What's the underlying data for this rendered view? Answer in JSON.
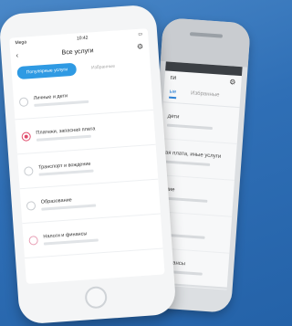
{
  "front_phone": {
    "status": {
      "carrier": "Mega ",
      "time": "10:42",
      "battery": ""
    },
    "nav": {
      "title": "Все услуги"
    },
    "tabs": {
      "active": "Популярные услуги",
      "inactive": "Избранные"
    },
    "items": [
      {
        "label": "Личные и дети"
      },
      {
        "label": "Платежи, запасная плата"
      },
      {
        "label": "Транспорт и вождение"
      },
      {
        "label": "Образование"
      },
      {
        "label": "Налоги и финансы"
      }
    ]
  },
  "back_phone": {
    "nav": {
      "title": "ги"
    },
    "tabs": {
      "active": "ые",
      "inactive": "Избранные"
    },
    "items": [
      {
        "label": "дети"
      },
      {
        "label": "ая плата, иные услуги"
      },
      {
        "label": "ение"
      },
      {
        "label": "ие"
      },
      {
        "label": "и финансы"
      }
    ]
  },
  "colors": {
    "accent": "#2f9ae3",
    "alert": "#e04a6a",
    "background": "#2f6fb6"
  }
}
